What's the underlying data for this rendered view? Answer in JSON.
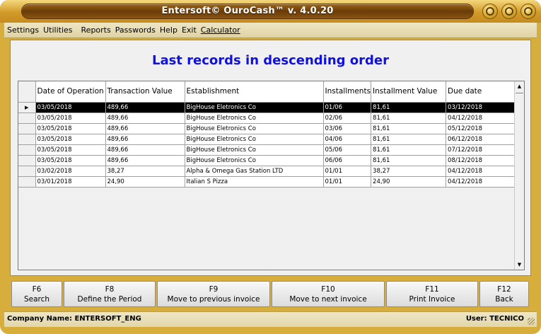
{
  "window": {
    "title": "Entersoft© OuroCash™ v. 4.0.20"
  },
  "menu": {
    "items": [
      {
        "label": "Settings"
      },
      {
        "label": "Utilities"
      },
      {
        "label": "Reports"
      },
      {
        "label": "Passwords"
      },
      {
        "label": "Help"
      },
      {
        "label": "Exit"
      },
      {
        "label": "Calculator"
      }
    ]
  },
  "main": {
    "heading": "Last records in descending order"
  },
  "table": {
    "columns": [
      "Date of Operation",
      "Transaction Value",
      "Establishment",
      "Installments",
      "Installment Value",
      "Due date"
    ],
    "rows": [
      [
        "03/05/2018",
        "489,66",
        "BigHouse Eletronics Co",
        "01/06",
        "81,61",
        "03/12/2018"
      ],
      [
        "03/05/2018",
        "489,66",
        "BigHouse Eletronics Co",
        "02/06",
        "81,61",
        "04/12/2018"
      ],
      [
        "03/05/2018",
        "489,66",
        "BigHouse Eletronics Co",
        "03/06",
        "81,61",
        "05/12/2018"
      ],
      [
        "03/05/2018",
        "489,66",
        "BigHouse Eletronics Co",
        "04/06",
        "81,61",
        "06/12/2018"
      ],
      [
        "03/05/2018",
        "489,66",
        "BigHouse Eletronics Co",
        "05/06",
        "81,61",
        "07/12/2018"
      ],
      [
        "03/05/2018",
        "489,66",
        "BigHouse Eletronics Co",
        "06/06",
        "81,61",
        "08/12/2018"
      ],
      [
        "03/02/2018",
        "38,27",
        "Alpha & Omega Gas Station LTD",
        "01/01",
        "38,27",
        "04/12/2018"
      ],
      [
        "03/01/2018",
        "24,90",
        "Italian S Pizza",
        "01/01",
        "24,90",
        "04/12/2018"
      ]
    ],
    "selected_row": 0,
    "row_pointer_icon": "row-pointer-icon"
  },
  "function_keys": [
    {
      "key": "F6",
      "label": "Search"
    },
    {
      "key": "F8",
      "label": "Define the Period"
    },
    {
      "key": "F9",
      "label": "Move to previous invoice"
    },
    {
      "key": "F10",
      "label": "Move to next invoice"
    },
    {
      "key": "F11",
      "label": "Print Invoice"
    },
    {
      "key": "F12",
      "label": "Back"
    }
  ],
  "status": {
    "company": "Company Name: ENTERSOFT_ENG",
    "user": "User: TECNICO"
  },
  "colors": {
    "accent_gold": "#d7ae3c",
    "heading_blue": "#1010e0"
  }
}
